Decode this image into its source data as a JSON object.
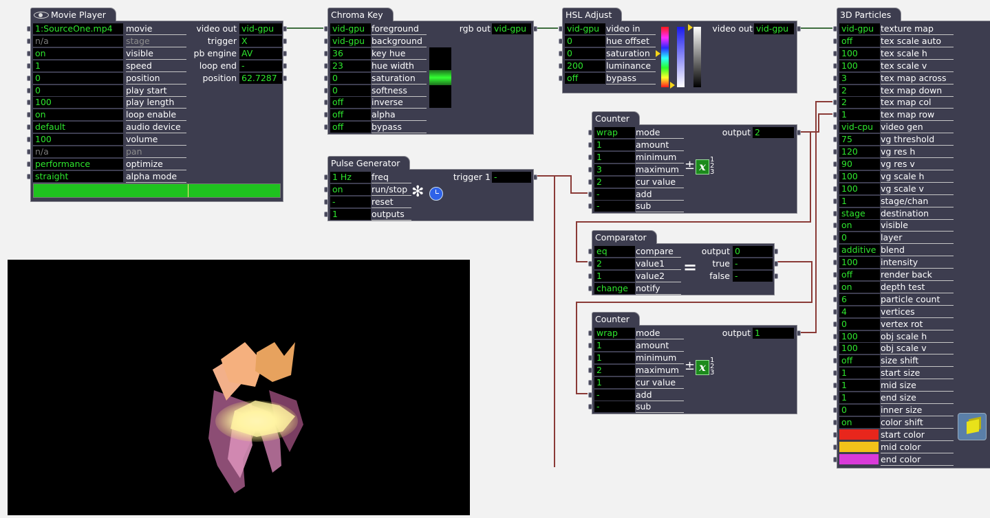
{
  "movie_player": {
    "title": "Movie Player",
    "inputs": [
      {
        "value": "1:SourceOne.mp4",
        "label": "movie",
        "dim": false
      },
      {
        "value": "n/a",
        "label": "stage",
        "dim": true
      },
      {
        "value": "on",
        "label": "visible",
        "dim": false
      },
      {
        "value": "1",
        "label": "speed",
        "dim": false
      },
      {
        "value": "0",
        "label": "position",
        "dim": false
      },
      {
        "value": "0",
        "label": "play start",
        "dim": false
      },
      {
        "value": "100",
        "label": "play length",
        "dim": false
      },
      {
        "value": "on",
        "label": "loop enable",
        "dim": false
      },
      {
        "value": "default",
        "label": "audio device",
        "dim": false
      },
      {
        "value": "100",
        "label": "volume",
        "dim": false
      },
      {
        "value": "n/a",
        "label": "pan",
        "dim": true
      },
      {
        "value": "performance",
        "label": "optimize",
        "dim": false
      },
      {
        "value": "straight",
        "label": "alpha mode",
        "dim": false
      }
    ],
    "outputs": [
      {
        "label": "video out",
        "value": "vid-gpu"
      },
      {
        "label": "trigger",
        "value": "X"
      },
      {
        "label": "pb engine",
        "value": "AV"
      },
      {
        "label": "loop end",
        "value": "-"
      },
      {
        "label": "position",
        "value": "62.7287"
      }
    ],
    "progress": 0.627
  },
  "chroma_key": {
    "title": "Chroma Key",
    "inputs": [
      {
        "value": "vid-gpu",
        "label": "foreground"
      },
      {
        "value": "vid-gpu",
        "label": "background"
      },
      {
        "value": "36",
        "label": "key hue"
      },
      {
        "value": "23",
        "label": "hue width"
      },
      {
        "value": "0",
        "label": "saturation"
      },
      {
        "value": "0",
        "label": "softness"
      },
      {
        "value": "off",
        "label": "inverse"
      },
      {
        "value": "off",
        "label": "alpha"
      },
      {
        "value": "off",
        "label": "bypass"
      }
    ],
    "outputs": [
      {
        "label": "rgb out",
        "value": "vid-gpu"
      }
    ]
  },
  "hsl_adjust": {
    "title": "HSL Adjust",
    "inputs": [
      {
        "value": "vid-gpu",
        "label": "video in"
      },
      {
        "value": "0",
        "label": "hue offset"
      },
      {
        "value": "0",
        "label": "saturation"
      },
      {
        "value": "200",
        "label": "luminance"
      },
      {
        "value": "off",
        "label": "bypass"
      }
    ],
    "outputs": [
      {
        "label": "video out",
        "value": "vid-gpu"
      }
    ]
  },
  "pulse_generator": {
    "title": "Pulse Generator",
    "inputs": [
      {
        "value": "1 Hz",
        "label": "freq"
      },
      {
        "value": "on",
        "label": "run/stop"
      },
      {
        "value": "-",
        "label": "reset"
      },
      {
        "value": "1",
        "label": "outputs"
      }
    ],
    "outputs": [
      {
        "label": "trigger 1",
        "value": "-"
      }
    ]
  },
  "counter_1": {
    "title": "Counter",
    "inputs": [
      {
        "value": "wrap",
        "label": "mode"
      },
      {
        "value": "1",
        "label": "amount"
      },
      {
        "value": "1",
        "label": "minimum"
      },
      {
        "value": "3",
        "label": "maximum"
      },
      {
        "value": "2",
        "label": "cur value"
      },
      {
        "value": "-",
        "label": "add"
      },
      {
        "value": "-",
        "label": "sub"
      }
    ],
    "outputs": [
      {
        "label": "output",
        "value": "2"
      }
    ]
  },
  "comparator": {
    "title": "Comparator",
    "inputs": [
      {
        "value": "eq",
        "label": "compare"
      },
      {
        "value": "2",
        "label": "value1"
      },
      {
        "value": "1",
        "label": "value2"
      },
      {
        "value": "change",
        "label": "notify"
      }
    ],
    "outputs": [
      {
        "label": "output",
        "value": "0"
      },
      {
        "label": "true",
        "value": "-"
      },
      {
        "label": "false",
        "value": "-"
      }
    ]
  },
  "counter_2": {
    "title": "Counter",
    "inputs": [
      {
        "value": "wrap",
        "label": "mode"
      },
      {
        "value": "1",
        "label": "amount"
      },
      {
        "value": "1",
        "label": "minimum"
      },
      {
        "value": "2",
        "label": "maximum"
      },
      {
        "value": "1",
        "label": "cur value"
      },
      {
        "value": "-",
        "label": "add"
      },
      {
        "value": "-",
        "label": "sub"
      }
    ],
    "outputs": [
      {
        "label": "output",
        "value": "1"
      }
    ]
  },
  "particles": {
    "title": "3D Particles",
    "inputs": [
      {
        "value": "vid-gpu",
        "label": "texture map"
      },
      {
        "value": "off",
        "label": "tex scale auto"
      },
      {
        "value": "100",
        "label": "tex scale h"
      },
      {
        "value": "100",
        "label": "tex scale v"
      },
      {
        "value": "3",
        "label": "tex map across"
      },
      {
        "value": "2",
        "label": "tex map down"
      },
      {
        "value": "2",
        "label": "tex map col"
      },
      {
        "value": "1",
        "label": "tex map row"
      },
      {
        "value": "vid-cpu",
        "label": "video gen"
      },
      {
        "value": "75",
        "label": "vg threshold"
      },
      {
        "value": "120",
        "label": "vg res h"
      },
      {
        "value": "90",
        "label": "vg res v"
      },
      {
        "value": "100",
        "label": "vg scale h"
      },
      {
        "value": "100",
        "label": "vg scale v"
      },
      {
        "value": "1",
        "label": "stage/chan"
      },
      {
        "value": "stage",
        "label": "destination"
      },
      {
        "value": "on",
        "label": "visible"
      },
      {
        "value": "0",
        "label": "layer"
      },
      {
        "value": "additive",
        "label": "blend"
      },
      {
        "value": "100",
        "label": "intensity"
      },
      {
        "value": "off",
        "label": "render back"
      },
      {
        "value": "on",
        "label": "depth test"
      },
      {
        "value": "6",
        "label": "particle count"
      },
      {
        "value": "4",
        "label": "vertices"
      },
      {
        "value": "0",
        "label": "vertex rot"
      },
      {
        "value": "100",
        "label": "obj scale h"
      },
      {
        "value": "100",
        "label": "obj scale v"
      },
      {
        "value": "off",
        "label": "size shift"
      },
      {
        "value": "1",
        "label": "start size"
      },
      {
        "value": "1",
        "label": "mid size"
      },
      {
        "value": "1",
        "label": "end size"
      },
      {
        "value": "0",
        "label": "inner size"
      },
      {
        "value": "on",
        "label": "color shift"
      }
    ],
    "colors": [
      {
        "label": "start color",
        "color": "#e8261c"
      },
      {
        "label": "mid color",
        "color": "#f2c21a"
      },
      {
        "label": "end color",
        "color": "#d93ad9"
      }
    ]
  },
  "wire_colors": {
    "video": "#3e6e3e",
    "value": "#8a3a36"
  }
}
